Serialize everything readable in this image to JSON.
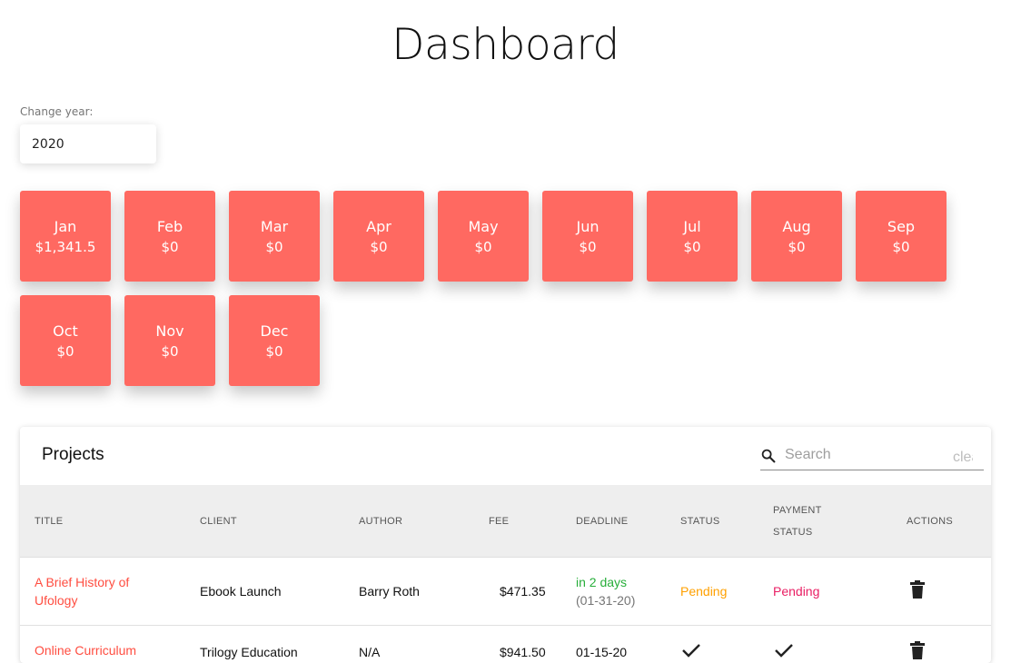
{
  "page": {
    "title": "Dashboard"
  },
  "year_selector": {
    "label": "Change year:",
    "value": "2020"
  },
  "months": [
    {
      "name": "Jan",
      "amount": "$1,341.5"
    },
    {
      "name": "Feb",
      "amount": "$0"
    },
    {
      "name": "Mar",
      "amount": "$0"
    },
    {
      "name": "Apr",
      "amount": "$0"
    },
    {
      "name": "May",
      "amount": "$0"
    },
    {
      "name": "Jun",
      "amount": "$0"
    },
    {
      "name": "Jul",
      "amount": "$0"
    },
    {
      "name": "Aug",
      "amount": "$0"
    },
    {
      "name": "Sep",
      "amount": "$0"
    },
    {
      "name": "Oct",
      "amount": "$0"
    },
    {
      "name": "Nov",
      "amount": "$0"
    },
    {
      "name": "Dec",
      "amount": "$0"
    }
  ],
  "colors": {
    "month_card": "#ff6961",
    "title_link": "#ff4d40",
    "deadline_soon": "#27ae3a",
    "status_pending": "#ffa000",
    "payment_pending": "#e91e63"
  },
  "projects": {
    "title": "Projects",
    "search": {
      "placeholder": "Search",
      "clear_label": "clear",
      "icon": "search-icon"
    },
    "columns": {
      "title": "TITLE",
      "client": "CLIENT",
      "author": "AUTHOR",
      "fee": "FEE",
      "deadline": "DEADLINE",
      "status": "STATUS",
      "payment_status_line1": "PAYMENT",
      "payment_status_line2": "STATUS",
      "actions": "ACTIONS"
    },
    "rows": [
      {
        "title_line1": "A Brief History of",
        "title_line2": "Ufology",
        "client": "Ebook Launch",
        "author": "Barry Roth",
        "fee": "$471.35",
        "deadline": "in 2 days",
        "deadline_date": "(01-31-20)",
        "status": "Pending",
        "payment_status": "Pending",
        "action_icon": "trash-icon"
      },
      {
        "title_line1": "Online Curriculum",
        "client": "Trilogy Education",
        "author": "N/A",
        "fee": "$941.50",
        "deadline": "01-15-20",
        "status_icon": "check-icon",
        "payment_status_icon": "check-icon",
        "action_icon": "trash-icon"
      }
    ]
  }
}
